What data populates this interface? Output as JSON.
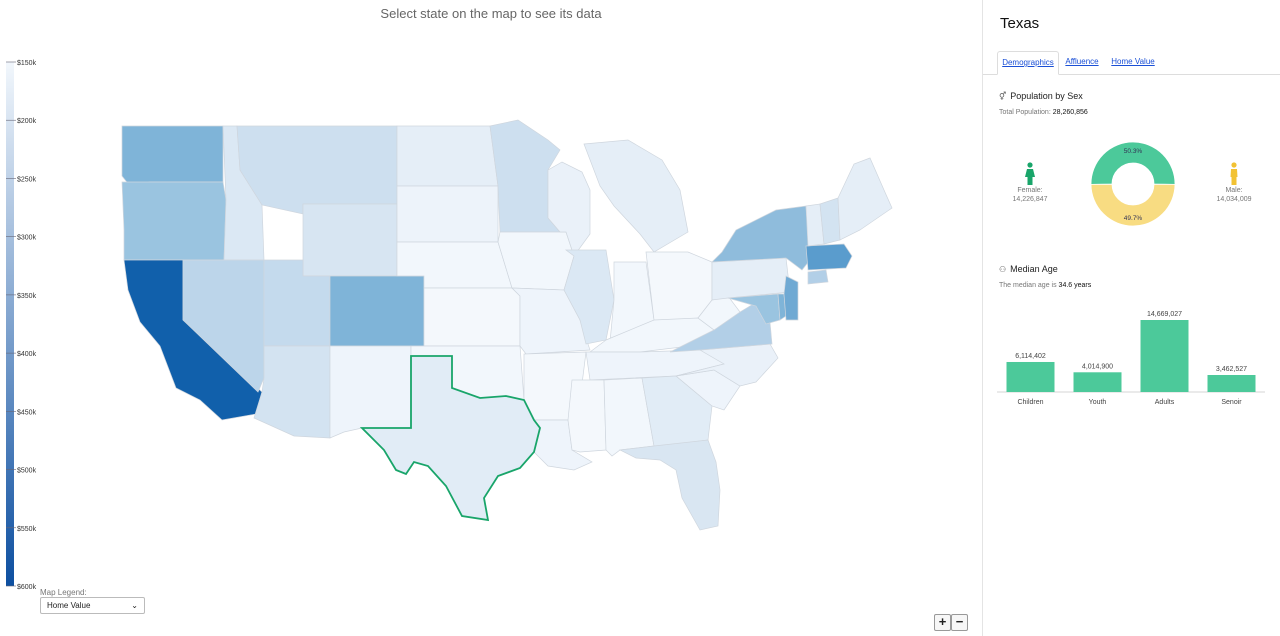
{
  "map": {
    "title": "Select state on the map to see its data",
    "legend_ticks": [
      "$150k",
      "$200k",
      "$250k",
      "$300k",
      "$350k",
      "$400k",
      "$450k",
      "$500k",
      "$550k",
      "$600k"
    ],
    "legend_label": "Map Legend:",
    "legend_select_value": "Home Value",
    "selected_state": "Texas",
    "zoom_in": "+",
    "zoom_out": "−",
    "colors": {
      "lightest": "#f2f7fc",
      "darkest": "#0d4fa0",
      "highlight": "#19a56a"
    }
  },
  "panel": {
    "state_name": "Texas",
    "tabs": [
      "Demographics",
      "Affluence",
      "Home Value"
    ],
    "active_tab": "Demographics",
    "population": {
      "title": "Population by Sex",
      "total_label": "Total Population:",
      "total_value": "28,260,856",
      "female_label": "Female:",
      "female_value": "14,226,847",
      "male_label": "Male:",
      "male_value": "14,034,009",
      "female_pct": "50.3%",
      "male_pct": "49.7%",
      "female_color": "#4cc99a",
      "male_color": "#f8dc82"
    },
    "age": {
      "title": "Median Age",
      "text_prefix": "The median age is",
      "value": "34.6 years"
    }
  },
  "chart_data": {
    "type": "bar",
    "categories": [
      "Children",
      "Youth",
      "Adults",
      "Senoir"
    ],
    "values": [
      6114402,
      4014900,
      14669027,
      3462527
    ],
    "value_labels": [
      "6,114,402",
      "4,014,900",
      "14,669,027",
      "3,462,527"
    ],
    "color": "#4cc99a"
  }
}
